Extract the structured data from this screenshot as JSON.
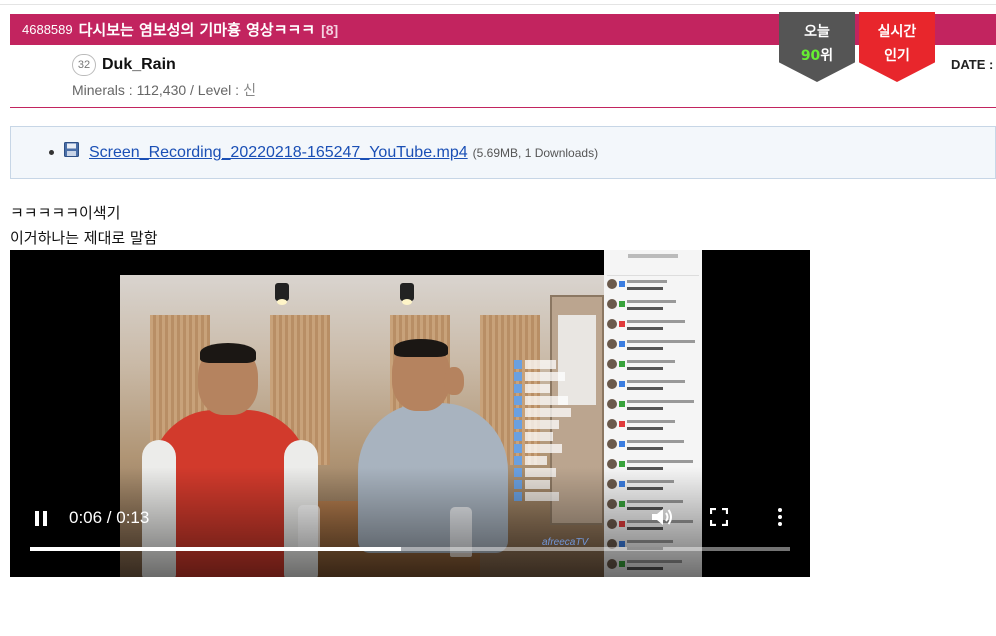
{
  "post": {
    "id": "4688589",
    "title": "다시보는 염보성의 기마흉 영상ㅋㅋㅋ",
    "comment_count": "[8]"
  },
  "badges": {
    "today_label": "오늘",
    "today_rank_number": "90",
    "today_rank_suffix": "위",
    "hot_line1": "실시간",
    "hot_line2": "인기"
  },
  "author": {
    "level_number": "32",
    "name": "Duk_Rain",
    "minerals_text": "Minerals : 112,430 / Level :",
    "level_name": "신"
  },
  "date_label": "DATE :",
  "attachment": {
    "icon": "floppy-disk-icon",
    "filename": "Screen_Recording_20220218-165247_YouTube.mp4",
    "meta": "(5.69MB, 1 Downloads)"
  },
  "content": {
    "line1": "ㅋㅋㅋㅋㅋ이색기",
    "line2": "이거하나는 제대로 말함"
  },
  "video": {
    "time": "0:06 / 0:13",
    "progress_fraction": 0.4878,
    "watermark": "afreecaTV",
    "icons": [
      "pause-icon",
      "volume-icon",
      "fullscreen-icon",
      "more-vert-icon"
    ]
  },
  "colors": {
    "title_bar": "#c2245f",
    "badge_today": "#555555",
    "badge_hot": "#e8262c",
    "rank_number": "#66ee33",
    "link": "#1a4fb5"
  }
}
